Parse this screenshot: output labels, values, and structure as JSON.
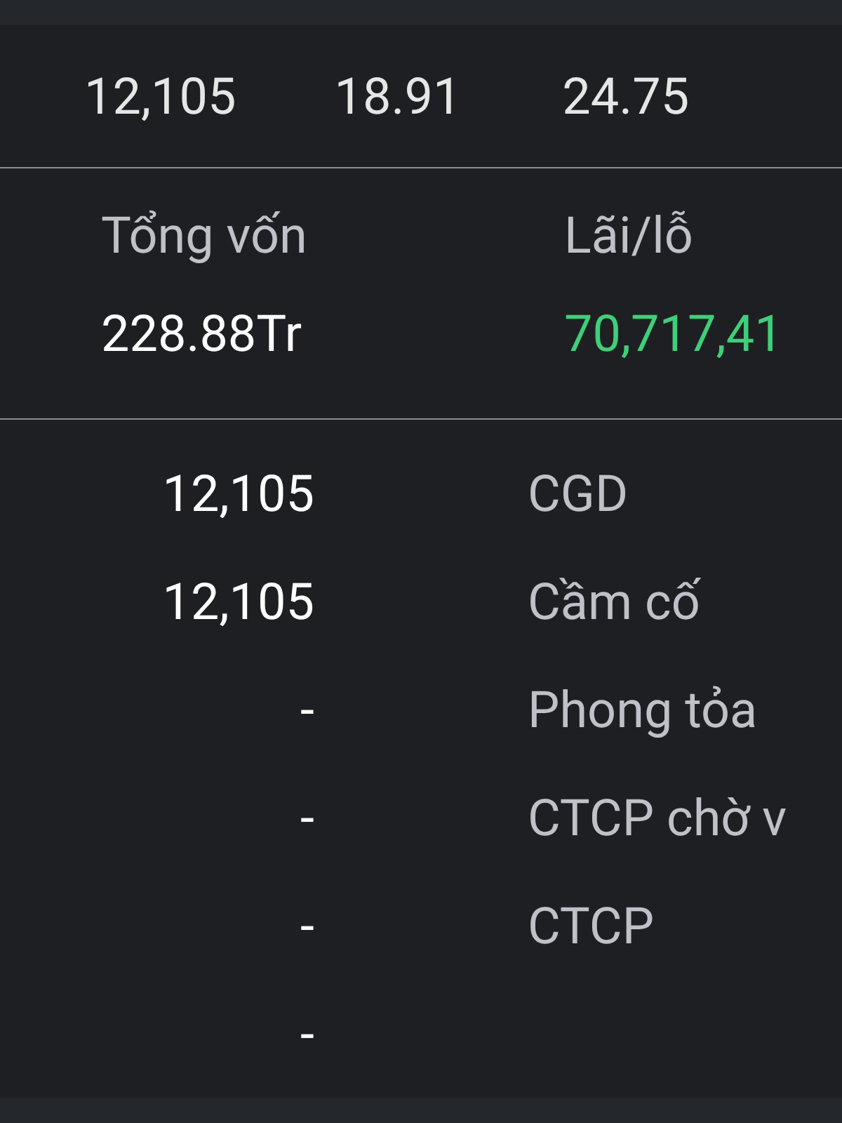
{
  "top_row": [
    "12,105",
    "18.91",
    "24.75"
  ],
  "summary": [
    {
      "label": "Tổng vốn",
      "value": "228.88Tr",
      "kind": "plain"
    },
    {
      "label": "Lãi/lỗ",
      "value": "70,717,41",
      "kind": "gain"
    }
  ],
  "details": [
    {
      "value": "12,105",
      "label": "CGD"
    },
    {
      "value": "12,105",
      "label": "Cầm cố"
    },
    {
      "value": "-",
      "label": "Phong tỏa"
    },
    {
      "value": "-",
      "label": "CTCP chờ v"
    },
    {
      "value": "-",
      "label": "CTCP"
    },
    {
      "value": "-"
    }
  ]
}
